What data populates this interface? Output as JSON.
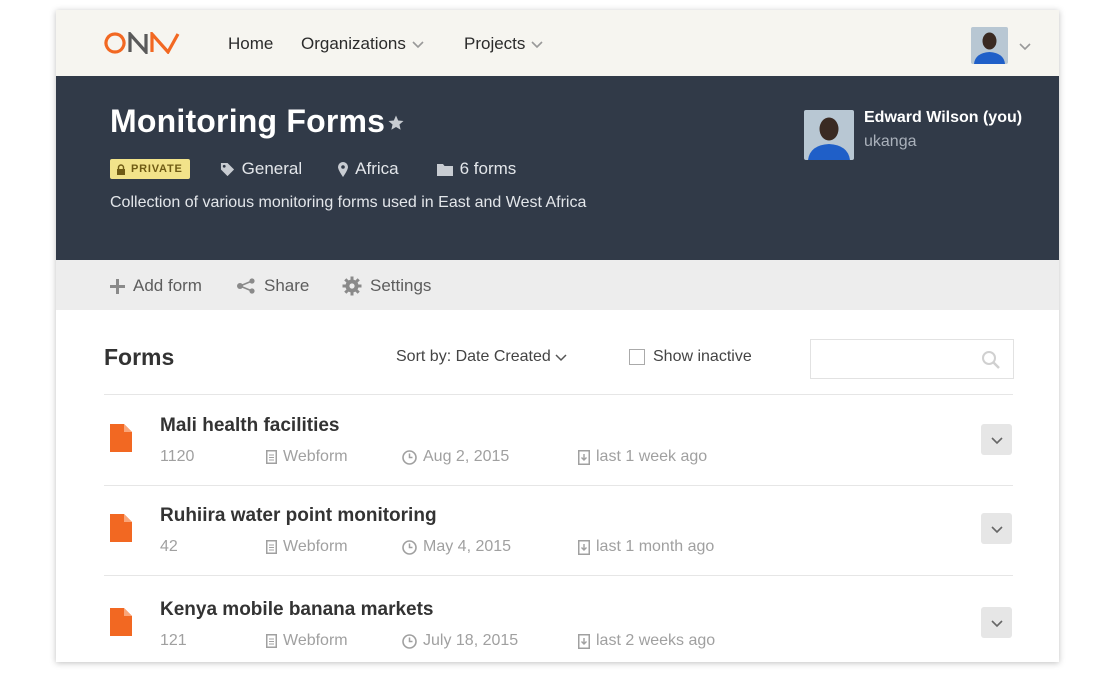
{
  "nav": {
    "home": "Home",
    "organizations": "Organizations",
    "projects": "Projects"
  },
  "project": {
    "title": "Monitoring Forms",
    "badge": "PRIVATE",
    "category": "General",
    "location": "Africa",
    "form_count": "6 forms",
    "description": "Collection of various monitoring forms used in East and West Africa",
    "owner_name": "Edward Wilson (you)",
    "owner_username": "ukanga"
  },
  "toolbar": {
    "add_form": "Add form",
    "share": "Share",
    "settings": "Settings"
  },
  "forms_section": {
    "title": "Forms",
    "sort_label": "Sort by: Date Created",
    "show_inactive": "Show inactive",
    "search_placeholder": ""
  },
  "forms": [
    {
      "name": "Mali health facilities",
      "submissions": "1120",
      "type": "Webform",
      "date": "Aug 2, 2015",
      "last": "last 1 week ago"
    },
    {
      "name": "Ruhiira water point monitoring",
      "submissions": "42",
      "type": "Webform",
      "date": "May 4, 2015",
      "last": "last 1 month ago"
    },
    {
      "name": "Kenya mobile banana markets",
      "submissions": "121",
      "type": "Webform",
      "date": "July 18, 2015",
      "last": "last 2 weeks ago"
    }
  ],
  "colors": {
    "brand_orange": "#f26822",
    "header_bg": "#313a48",
    "nav_bg": "#f6f5f0",
    "badge_bg": "#f2e38a"
  }
}
